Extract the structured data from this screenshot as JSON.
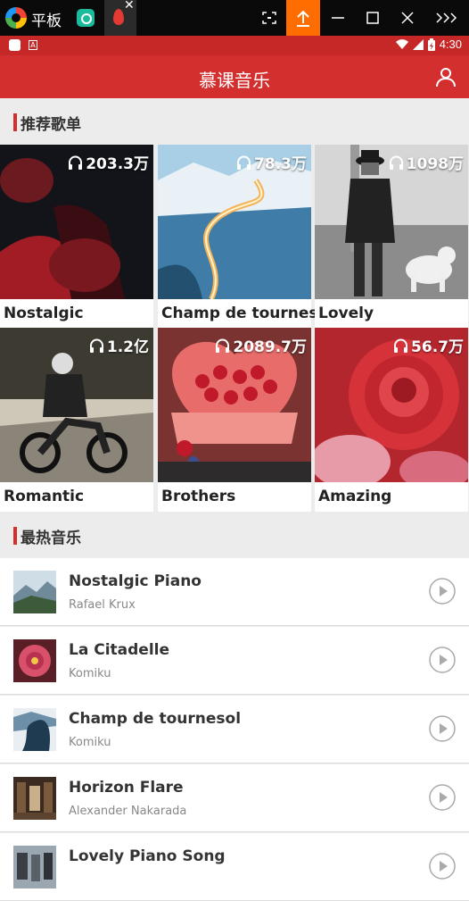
{
  "host": {
    "title": "平板"
  },
  "status_bar": {
    "time": "4:30"
  },
  "toolbar": {
    "title": "慕课音乐"
  },
  "recommended": {
    "title": "推荐歌单",
    "playlists": [
      {
        "name": "Nostalgic",
        "plays": "203.3万"
      },
      {
        "name": "Champ de tournesol",
        "plays": "78.3万"
      },
      {
        "name": "Lovely",
        "plays": "1098万"
      },
      {
        "name": "Romantic",
        "plays": "1.2亿"
      },
      {
        "name": "Brothers",
        "plays": "2089.7万"
      },
      {
        "name": "Amazing",
        "plays": "56.7万"
      }
    ]
  },
  "hot": {
    "title": "最热音乐",
    "songs": [
      {
        "title": "Nostalgic Piano",
        "artist": "Rafael Krux"
      },
      {
        "title": "La Citadelle",
        "artist": "Komiku"
      },
      {
        "title": "Champ de tournesol",
        "artist": "Komiku"
      },
      {
        "title": "Horizon Flare",
        "artist": "Alexander Nakarada"
      },
      {
        "title": "Lovely Piano Song",
        "artist": ""
      }
    ]
  },
  "colors": {
    "accent": "#d32f2f",
    "status_bar": "#c62828",
    "host_upload": "#ff6d00"
  },
  "icons": [
    "app-logo-icon",
    "flame-icon",
    "screenshot-icon",
    "upload-icon",
    "minimize-icon",
    "maximize-icon",
    "close-icon",
    "more-icon",
    "user-icon",
    "headphone-icon",
    "play-icon",
    "wifi-icon",
    "signal-icon",
    "battery-icon"
  ]
}
